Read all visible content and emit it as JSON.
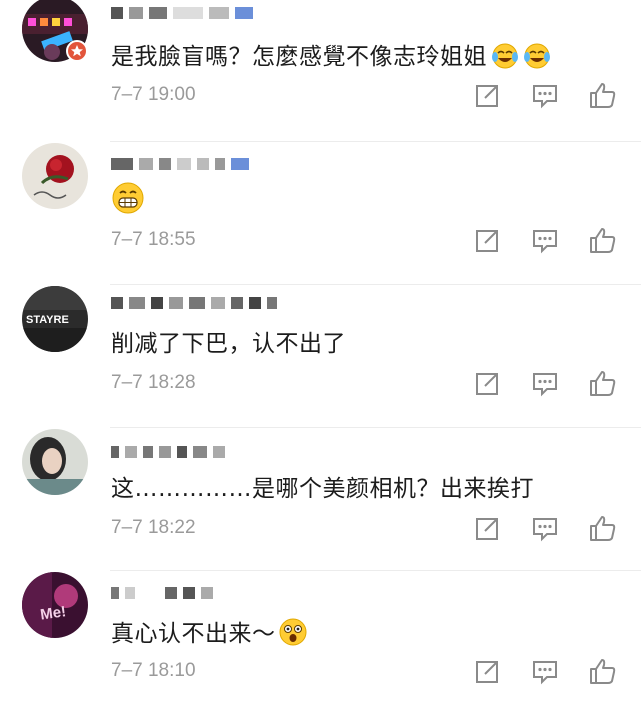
{
  "comments": [
    {
      "text": "是我臉盲嗎？怎麼感覺不像志玲姐姐",
      "emojis": [
        "laugh-cry-emoji",
        "laugh-cry-emoji"
      ],
      "time": "7–7 19:00",
      "verified": true,
      "avatar": "led-sign-avatar"
    },
    {
      "text": "",
      "emojis": [
        "grin-emoji"
      ],
      "time": "7–7 18:55",
      "verified": false,
      "avatar": "rose-avatar"
    },
    {
      "text": "削减了下巴，认不出了",
      "emojis": [],
      "time": "7–7 18:28",
      "verified": false,
      "avatar": "stayreal-avatar",
      "avatar_text": "STAYRE"
    },
    {
      "text": "这……………是哪个美颜相机？出来挨打",
      "emojis": [],
      "time": "7–7 18:22",
      "verified": false,
      "avatar": "girl-avatar"
    },
    {
      "text": "真心认不出来～",
      "emojis": [
        "shocked-emoji"
      ],
      "time": "7–7 18:10",
      "verified": false,
      "avatar": "neon-avatar",
      "avatar_text": "Me!"
    }
  ],
  "actions": [
    "repost-icon",
    "comment-icon",
    "like-icon"
  ],
  "colors": {
    "time": "#9a9a9a",
    "icon": "#8a8a8a",
    "text": "#1c1c1c",
    "badge": "#e2553b",
    "blurBlue": "#6b8fd9"
  }
}
